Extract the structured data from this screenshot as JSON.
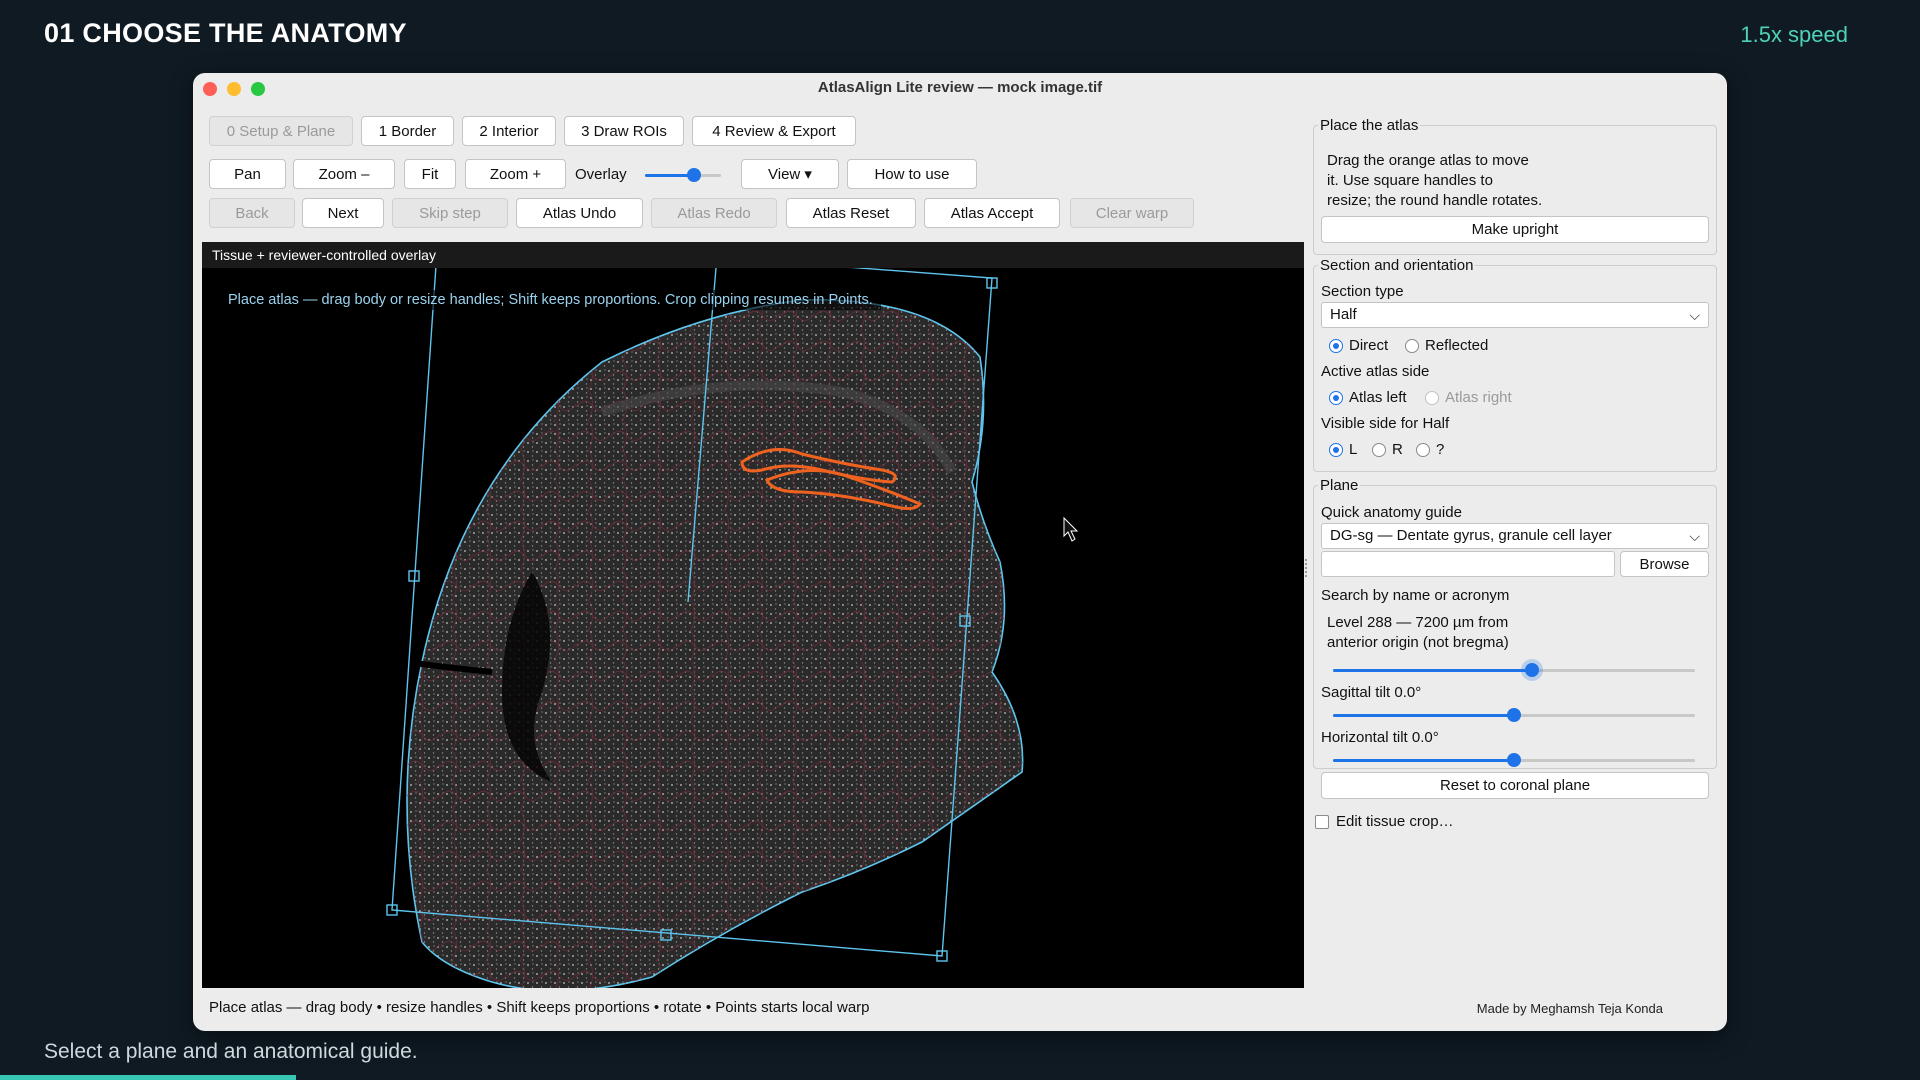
{
  "header": {
    "step_title": "01  CHOOSE THE ANATOMY",
    "speed": "1.5x speed",
    "caption": "Select a plane and an anatomical guide."
  },
  "window": {
    "title": "AtlasAlign Lite review — mock image.tif"
  },
  "steps": {
    "setup": "0 Setup & Plane",
    "border": "1 Border",
    "interior": "2 Interior",
    "draw_rois": "3 Draw ROIs",
    "review": "4 Review & Export"
  },
  "toolbar": {
    "pan": "Pan",
    "zoom_out": "Zoom –",
    "fit": "Fit",
    "zoom_in": "Zoom +",
    "overlay_label": "Overlay",
    "overlay_opacity": 0.65,
    "view": "View ▾",
    "how_to": "How to use"
  },
  "actions": {
    "back": "Back",
    "next": "Next",
    "skip": "Skip step",
    "undo": "Atlas Undo",
    "redo": "Atlas Redo",
    "reset": "Atlas Reset",
    "accept": "Atlas Accept",
    "clear_warp": "Clear warp"
  },
  "canvas": {
    "title": "Tissue + reviewer-controlled overlay",
    "hint": "Place atlas — drag body or resize handles; Shift keeps proportions. Crop clipping resumes in Points."
  },
  "status": {
    "left": "Place atlas — drag body • resize handles • Shift keeps proportions • rotate • Points starts local warp",
    "right": "Made by Meghamsh Teja Konda"
  },
  "place_atlas": {
    "title": "Place the atlas",
    "line1": "Drag the orange atlas to move",
    "line2": "it. Use square handles to",
    "line3": "resize; the round handle rotates.",
    "make_upright": "Make upright"
  },
  "section": {
    "title": "Section and orientation",
    "type_label": "Section type",
    "type_value": "Half",
    "direct": "Direct",
    "reflected": "Reflected",
    "active_side_label": "Active atlas side",
    "atlas_left": "Atlas left",
    "atlas_right": "Atlas right",
    "visible_label": "Visible side for Half",
    "side_l": "L",
    "side_r": "R",
    "side_q": "?"
  },
  "plane": {
    "title": "Plane",
    "guide_label": "Quick anatomy guide",
    "guide_value": "DG-sg — Dentate gyrus, granule cell layer",
    "browse": "Browse",
    "search_label": "Search by name or acronym",
    "level_line1": "Level 288 — 7200 µm from",
    "level_line2": "anterior origin (not bregma)",
    "level_fraction": 0.55,
    "sag_label": "Sagittal tilt 0.0°",
    "sag_fraction": 0.5,
    "hor_label": "Horizontal tilt 0.0°",
    "hor_fraction": 0.5,
    "reset_plane": "Reset to coronal plane"
  },
  "crop": {
    "label": "Edit tissue crop…"
  }
}
